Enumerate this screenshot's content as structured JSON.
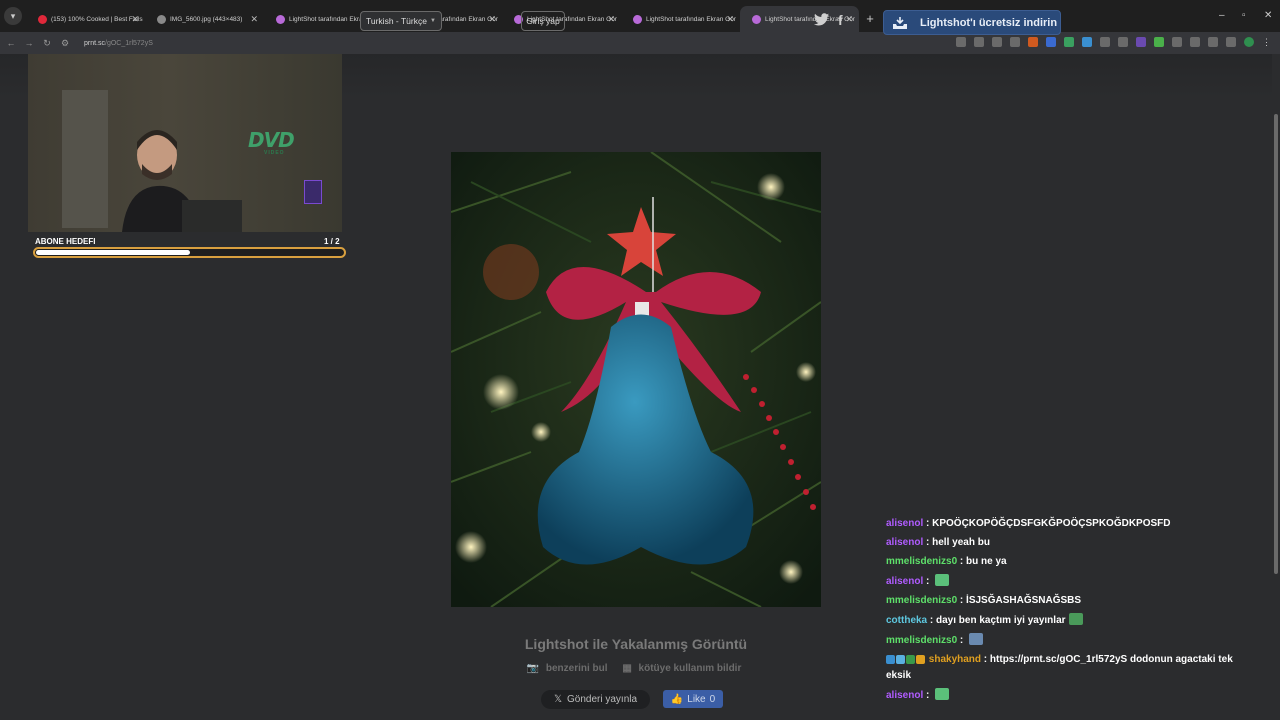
{
  "browser": {
    "tabs": [
      {
        "label": "(153) 100% Cooked | Best Fails",
        "icon": "youtube-icon",
        "active": false
      },
      {
        "label": "IMG_5600.jpg (443×483)",
        "icon": "globe-icon",
        "active": false
      },
      {
        "label": "LightShot tarafından Ekran Gör",
        "icon": "lightshot-icon",
        "active": false
      },
      {
        "label": "LightShot tarafından Ekran Gör",
        "icon": "lightshot-icon",
        "active": false
      },
      {
        "label": "LightShot tarafından Ekran Gör",
        "icon": "lightshot-icon",
        "active": false
      },
      {
        "label": "LightShot tarafından Ekran Gör",
        "icon": "lightshot-icon",
        "active": false
      },
      {
        "label": "LightShot tarafından Ekran Gör",
        "icon": "lightshot-icon",
        "active": true
      }
    ],
    "url_host": "prnt.sc",
    "url_path": "/gOC_1rl572yS"
  },
  "header": {
    "language": "Turkish - Türkçe",
    "login": "Giriş yap",
    "download": "Lightshot'ı ücretsiz indirin"
  },
  "stream": {
    "goal_label": "ABONE HEDEFI",
    "goal_count": "1  / 2",
    "goal_progress": 0.5,
    "dvd_text": "DVD",
    "dvd_sub": "VIDEO"
  },
  "main": {
    "caption": "Lightshot ile Yakalanmış Görüntü",
    "find_similar": "benzerini bul",
    "report": "kötüye kullanım bildir",
    "post_label": "Gönderi yayınla",
    "like_label": "Like",
    "like_count": "0"
  },
  "chat": [
    {
      "user": "alisenol",
      "color": "#b05cff",
      "text": "KPOÖÇKOPÖĞÇDSFGKĞPOÖÇSPKOĞDKPOSFD"
    },
    {
      "user": "alisenol",
      "color": "#b05cff",
      "text": "hell yeah bu"
    },
    {
      "user": "mmelisdenizs0",
      "color": "#5ee06a",
      "text": "bu ne ya"
    },
    {
      "user": "alisenol",
      "color": "#b05cff",
      "text": "",
      "emote": "#5bc07a"
    },
    {
      "user": "mmelisdenizs0",
      "color": "#5ee06a",
      "text": "İSJSĞASHAĞSNAĞSBS"
    },
    {
      "user": "cottheka",
      "color": "#5ec8e0",
      "text": "dayı ben kaçtım iyi yayınlar",
      "emote": "#4a9a5a"
    },
    {
      "user": "mmelisdenizs0",
      "color": "#5ee06a",
      "text": "",
      "emote": "#6a8ab0"
    },
    {
      "user": "shakyhand",
      "color": "#e0a020",
      "text": "https://prnt.sc/gOC_1rl572yS dodonun agactaki tek eksik",
      "badges": [
        "#3a8fd0",
        "#5ab0e0",
        "#3a9a4a",
        "#e0a020"
      ]
    },
    {
      "user": "alisenol",
      "color": "#b05cff",
      "text": "",
      "emote": "#5bc07a"
    }
  ]
}
